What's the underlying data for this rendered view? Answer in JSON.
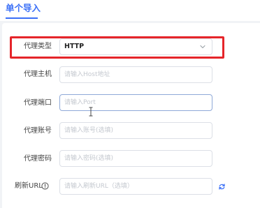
{
  "tabs": {
    "active_label": "单个导入"
  },
  "form": {
    "proxy_type": {
      "label": "代理类型",
      "value": "HTTP"
    },
    "proxy_host": {
      "label": "代理主机",
      "placeholder": "请输入Host地址"
    },
    "proxy_port": {
      "label": "代理端口",
      "placeholder": "请输入Port"
    },
    "proxy_account": {
      "label": "代理账号",
      "placeholder": "请输入账号(选填)"
    },
    "proxy_password": {
      "label": "代理密码",
      "placeholder": "请输入密码(选填)"
    },
    "refresh_url": {
      "label": "刷新URL",
      "placeholder": "请输入刷新URL（选填）"
    }
  },
  "colors": {
    "accent": "#3a6ff7",
    "highlight": "#e5252a"
  },
  "icons": {
    "select_chevron": "chevron-down-icon",
    "refresh_url_info": "info-icon",
    "refresh": "refresh-icon",
    "cursor": "text-cursor-icon"
  }
}
